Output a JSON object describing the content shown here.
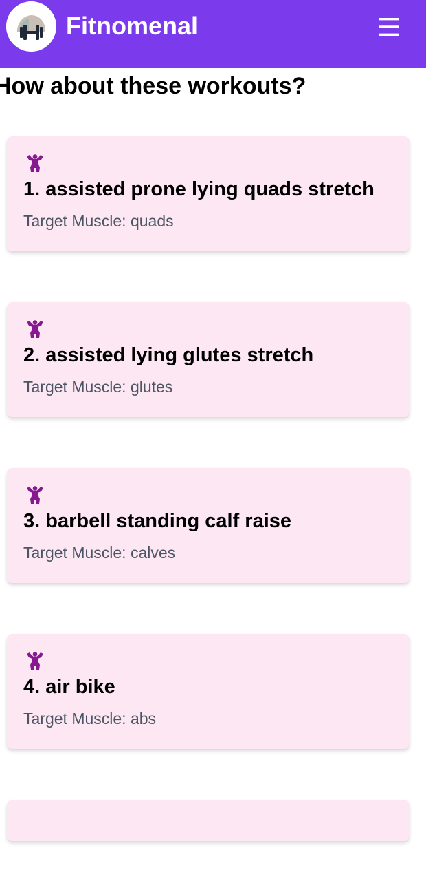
{
  "header": {
    "title": "Fitnomenal",
    "logo_icon": "dumbbell-logo-icon",
    "menu_icon": "hamburger-menu-icon",
    "background_color": "#7c3aed"
  },
  "page": {
    "title": "How about these workouts?"
  },
  "workouts": [
    {
      "title": "1. assisted prone lying quads stretch",
      "target": "Target Muscle: quads"
    },
    {
      "title": "2. assisted lying glutes stretch",
      "target": "Target Muscle: glutes"
    },
    {
      "title": "3. barbell standing calf raise",
      "target": "Target Muscle: calves"
    },
    {
      "title": "4. air bike",
      "target": "Target Muscle: abs"
    },
    {
      "title": "",
      "target": ""
    }
  ],
  "card_icon": "flexing-muscle-icon",
  "colors": {
    "card_background": "#fce7f3",
    "icon": "#86198f",
    "subtext": "#4b5563"
  }
}
